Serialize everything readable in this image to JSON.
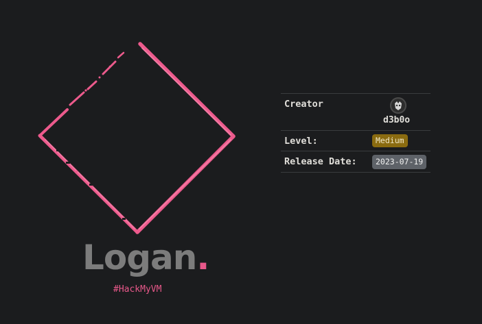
{
  "machine": {
    "name": "Logan",
    "dot": ".",
    "hashtag": "#HackMyVM",
    "accent_color": "#e8588a",
    "logo_icon": "diamond-outline-icon"
  },
  "info": {
    "creator_label": "Creator",
    "creator_name": "d3b0o",
    "avatar_icon": "creator-avatar",
    "level_label": "Level:",
    "level_value": "Medium",
    "level_color": "#8a6b10",
    "release_label": "Release Date:",
    "release_value": "2023-07-19"
  }
}
